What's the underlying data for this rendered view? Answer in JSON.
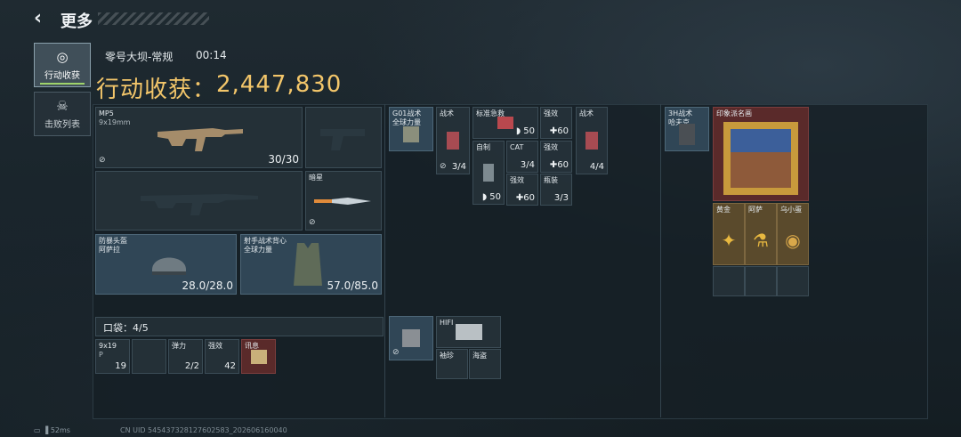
{
  "header": {
    "title": "更多"
  },
  "tabs": [
    {
      "label": "行动收获",
      "icon": "target-icon",
      "active": true
    },
    {
      "label": "击败列表",
      "icon": "skull-icon",
      "active": false
    }
  ],
  "match": {
    "map": "零号大坝-常规",
    "time": "00:14"
  },
  "haul": {
    "label": "行动收获：",
    "value": "2,447,830"
  },
  "equipment": {
    "primary": {
      "name": "MP5",
      "ammo": "9x19mm",
      "count": "30/30"
    },
    "melee": {
      "name": "暗星"
    },
    "helmet": {
      "name": "防暴头盔",
      "brand": "阿萨拉",
      "durability": "28.0/28.0"
    },
    "armor": {
      "name": "射手战术背心",
      "brand": "全球力量",
      "durability": "57.0/85.0"
    }
  },
  "pocket": {
    "label": "口袋：4/5",
    "items": [
      {
        "name": "9x19",
        "sub": "P",
        "count": "19"
      },
      {
        "name": "",
        "count": ""
      },
      {
        "name": "弹力",
        "count": "2/2"
      },
      {
        "name": "强效",
        "count": "42"
      },
      {
        "name": "讯息",
        "count": ""
      }
    ]
  },
  "chest_rig": {
    "name": "G01战术",
    "brand": "全球力量",
    "items": [
      {
        "name": "战术",
        "count": "3/4"
      },
      {
        "name": "标准急救",
        "count": "50"
      },
      {
        "name": "强效",
        "count": "60"
      },
      {
        "name": "战术",
        "count": "4/4"
      },
      {
        "name": "自制",
        "count": "50"
      },
      {
        "name": "CAT",
        "count": "3/4"
      },
      {
        "name": "强效",
        "count": "60"
      },
      {
        "name": "强效",
        "count": "60"
      },
      {
        "name": "瓶装",
        "count": "3/3"
      }
    ]
  },
  "case": {
    "items": [
      {
        "name": "HIFI",
        "count": ""
      },
      {
        "name": "袖珍",
        "count": ""
      },
      {
        "name": "海盗",
        "count": ""
      }
    ]
  },
  "backpack": {
    "name": "3H战术",
    "brand": "哈夫克",
    "items": [
      {
        "name": "印象派名画",
        "count": ""
      },
      {
        "name": "黄金",
        "count": ""
      },
      {
        "name": "阿萨",
        "count": ""
      },
      {
        "name": "乌小蛋",
        "count": ""
      }
    ]
  },
  "footer": {
    "ping": "52ms",
    "uid": "CN UID 545437328127602583_202606160040"
  },
  "colors": {
    "gold": "#f3c66a",
    "accent": "#9fd36a",
    "red_slot": "#5a2a2a",
    "gold_slot": "#5a4a2c"
  }
}
